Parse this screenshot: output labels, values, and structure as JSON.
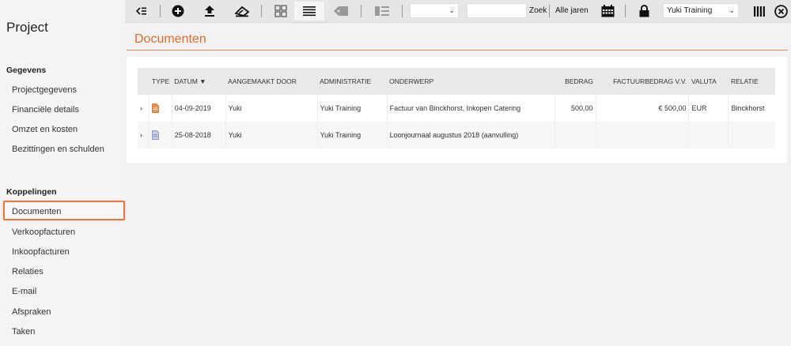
{
  "sidebar": {
    "title": "Project",
    "sections": [
      {
        "title": "Gegevens",
        "items": [
          "Projectgegevens",
          "Financiële details",
          "Omzet en kosten",
          "Bezittingen en schulden"
        ]
      },
      {
        "title": "Koppelingen",
        "items": [
          "Documenten",
          "Verkoopfacturen",
          "Inkoopfacturen",
          "Relaties",
          "E-mail",
          "Afspraken",
          "Taken"
        ]
      }
    ],
    "active_item": "Documenten"
  },
  "toolbar": {
    "search_placeholder": "",
    "search_button": "Zoek",
    "years_label": "Alle jaren",
    "filter_select": "",
    "administration_select": "Yuki Training"
  },
  "main": {
    "title": "Documenten",
    "table": {
      "columns": [
        "TYPE",
        "DATUM ▼",
        "AANGEMAAKT DOOR",
        "ADMINISTRATIE",
        "ONDERWERP",
        "BEDRAG",
        "FACTUURBEDRAG V.V.",
        "VALUTA",
        "RELATIE"
      ],
      "rows": [
        {
          "date": "04-09-2019",
          "created_by": "Yuki",
          "administration": "Yuki Training",
          "subject": "Factuur van Binckhorst, Inkopen Catering",
          "amount": "500,00",
          "invoice_amount": "€ 500,00",
          "currency": "EUR",
          "relation": "Binckhorst",
          "icon": "invoice-document-icon"
        },
        {
          "date": "25-08-2018",
          "created_by": "Yuki",
          "administration": "Yuki Training",
          "subject": "Loonjournaal augustus 2018 (aanvulling)",
          "amount": "",
          "invoice_amount": "",
          "currency": "",
          "relation": "",
          "icon": "journal-document-icon"
        }
      ]
    }
  },
  "colors": {
    "accent": "#e06c2e",
    "highlight": "#e47a3f",
    "toolbar_bg": "#e6e6e6"
  }
}
